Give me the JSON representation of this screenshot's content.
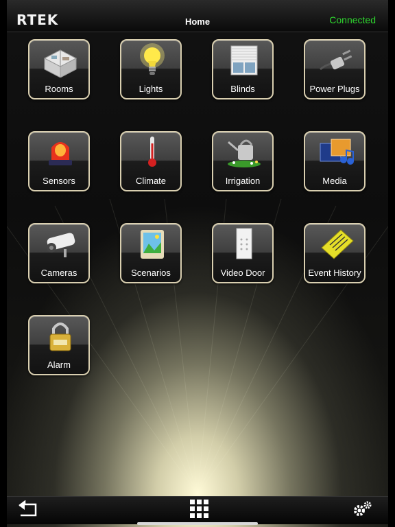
{
  "header": {
    "logo": "RTEK",
    "title": "Home",
    "status": "Connected",
    "status_color": "#2ed62e"
  },
  "tiles": [
    {
      "label": "Rooms",
      "icon": "rooms-icon"
    },
    {
      "label": "Lights",
      "icon": "lightbulb-icon"
    },
    {
      "label": "Blinds",
      "icon": "blinds-icon"
    },
    {
      "label": "Power Plugs",
      "icon": "power-plug-icon"
    },
    {
      "label": "Sensors",
      "icon": "siren-icon"
    },
    {
      "label": "Climate",
      "icon": "thermometer-icon"
    },
    {
      "label": "Irrigation",
      "icon": "watering-can-icon"
    },
    {
      "label": "Media",
      "icon": "media-icon"
    },
    {
      "label": "Cameras",
      "icon": "camera-icon"
    },
    {
      "label": "Scenarios",
      "icon": "scenarios-icon"
    },
    {
      "label": "Video Door",
      "icon": "keypad-icon"
    },
    {
      "label": "Event History",
      "icon": "notebook-icon"
    },
    {
      "label": "Alarm",
      "icon": "padlock-icon"
    }
  ],
  "footer": {
    "back": "back-arrow-icon",
    "menu": "grid-menu-icon",
    "settings": "gears-icon"
  }
}
